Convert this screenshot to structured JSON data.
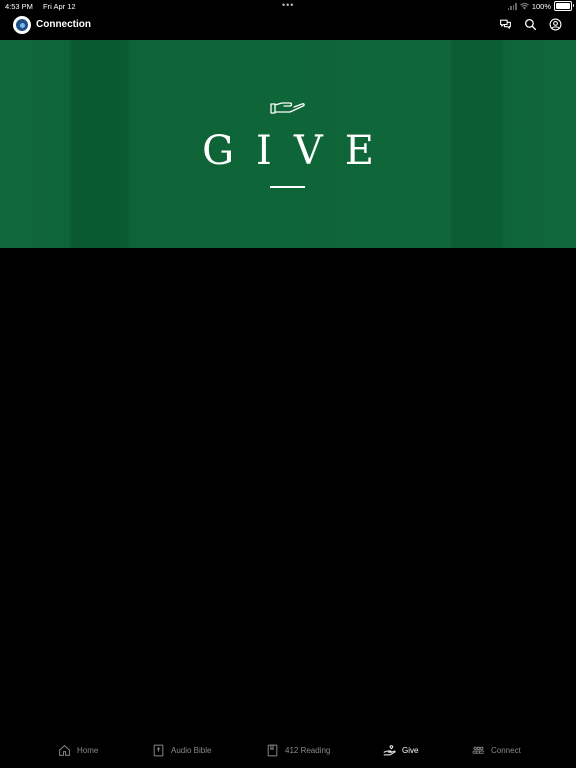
{
  "status_bar": {
    "time": "4:53 PM",
    "date": "Fri Apr 12",
    "multitask_dots": "•••",
    "battery": "100%"
  },
  "nav_bar": {
    "app_title": "Connection",
    "icons": [
      "chat-icon",
      "search-icon",
      "account-icon"
    ]
  },
  "hero": {
    "title": "GIVE",
    "icon": "giving-hand-icon",
    "background_color": "#0f6537"
  },
  "tab_bar": {
    "tabs": [
      {
        "label": "Home",
        "icon": "home-icon",
        "active": false
      },
      {
        "label": "Audio Bible",
        "icon": "bible-icon",
        "active": false
      },
      {
        "label": "412 Reading",
        "icon": "bookmark-book-icon",
        "active": false
      },
      {
        "label": "Give",
        "icon": "give-hand-icon",
        "active": true
      },
      {
        "label": "Connect",
        "icon": "group-icon",
        "active": false
      }
    ],
    "active_color": "#ffffff",
    "inactive_color": "#8a8a8a"
  }
}
